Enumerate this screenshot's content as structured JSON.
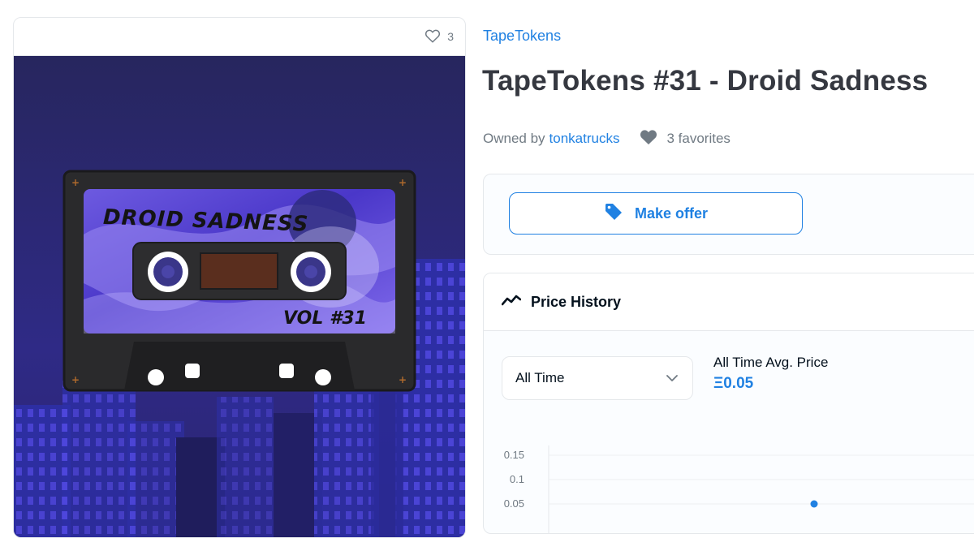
{
  "media": {
    "favorite_count": "3",
    "artwork": {
      "title_text": "DROID SADNESS",
      "volume_text": "VOL #31"
    }
  },
  "collection": {
    "name": "TapeTokens"
  },
  "item": {
    "title": "TapeTokens #31 - Droid Sadness"
  },
  "owner": {
    "prefix": "Owned by",
    "username": "tonkatrucks",
    "favorites_label": "3 favorites"
  },
  "offer": {
    "button_label": "Make offer"
  },
  "price_history": {
    "title": "Price History",
    "range_selected": "All Time",
    "avg_label": "All Time Avg. Price",
    "avg_value": "Ξ0.05"
  },
  "chart_data": {
    "type": "scatter",
    "y_ticks": [
      "0.15",
      "0.1",
      "0.05"
    ],
    "ylim": [
      0,
      0.15
    ],
    "points": [
      {
        "y": 0.05
      }
    ]
  },
  "colors": {
    "accent": "#2081e2",
    "text_primary": "#353840",
    "text_secondary": "#707a83",
    "art_background": "#2a2670"
  }
}
